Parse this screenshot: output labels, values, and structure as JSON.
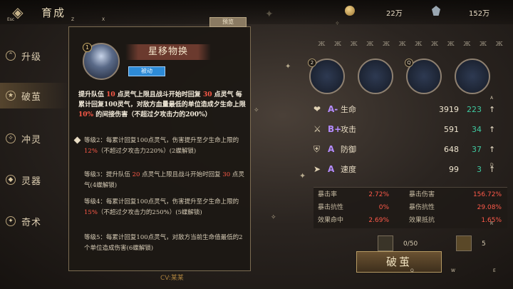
{
  "topbar": {
    "title": "育成",
    "esc_key": "Esc",
    "z_key": "Z",
    "x_key": "X",
    "coin_amount": "22万",
    "gem_amount": "152万"
  },
  "nav": {
    "items": [
      {
        "label": "升级"
      },
      {
        "label": "破茧"
      },
      {
        "label": "冲灵"
      },
      {
        "label": "灵器"
      },
      {
        "label": "奇术"
      }
    ]
  },
  "tooltip": {
    "preview_tab": "预览",
    "portrait_number": "1",
    "skill_name": "星移物换",
    "skill_tag": "被动",
    "desc_part1": "提升队伍 ",
    "desc_val1": "10",
    "desc_part2": " 点灵气上限且战斗开始时回复 ",
    "desc_val2": "30",
    "desc_part3": " 点灵气 每累计回复100灵气，对敌方血量最低的单位造成夕生命上限 ",
    "desc_val3": "10%",
    "desc_part4": " 的间接伤害（不超过夕攻击力的200%）",
    "levels": [
      {
        "a": "等级2：每累计回复100点灵气，伤害提升至夕生命上限的 ",
        "v": "12%",
        "b": "（不超过夕攻击力220%）(2蝶解锁)"
      },
      {
        "a": "等级3：提升队伍 ",
        "v": "20",
        "b": " 点灵气上限且战斗开始时回复 ",
        "v2": "30",
        "c": " 点灵气(4蝶解锁)"
      },
      {
        "a": "等级4：每累计回复100点灵气，伤害提升至夕生命上限的 ",
        "v": "15%",
        "b": "（不超过夕攻击力的250%）(5蝶解锁)"
      },
      {
        "a": "等级5：每累计回复100点灵气，对敌方当前生命值最低的2个单位造成伤害(6蝶解锁)"
      }
    ]
  },
  "right_panel": {
    "slots": [
      "2",
      "",
      "Q",
      ""
    ],
    "stats": [
      {
        "icon": "heart-icon",
        "grade": "A-",
        "name": "生命",
        "value": "3919",
        "bonus": "223"
      },
      {
        "icon": "attack-icon",
        "grade": "B+",
        "name": "攻击",
        "value": "591",
        "bonus": "34"
      },
      {
        "icon": "shield-icon",
        "grade": "A",
        "name": "防御",
        "value": "648",
        "bonus": "37"
      },
      {
        "icon": "speed-icon",
        "grade": "A",
        "name": "速度",
        "value": "99",
        "bonus": "3"
      }
    ],
    "secondary": [
      {
        "label": "暴击率",
        "value": "2.72%"
      },
      {
        "label": "暴击伤害",
        "value": "156.72%"
      },
      {
        "label": "暴击抗性",
        "value": "0%"
      },
      {
        "label": "暴伤抗性",
        "value": "29.08%"
      },
      {
        "label": "效果命中",
        "value": "2.69%"
      },
      {
        "label": "效果抵抗",
        "value": "1.65%"
      }
    ],
    "material_count": "0/50",
    "item_count": "5",
    "breach_button": "破茧",
    "q_key": "Q",
    "w_key": "W",
    "e_key": "E",
    "a_key": "A",
    "r_key": "R",
    "d_key": "D",
    "cv_text": "CV:某某"
  }
}
